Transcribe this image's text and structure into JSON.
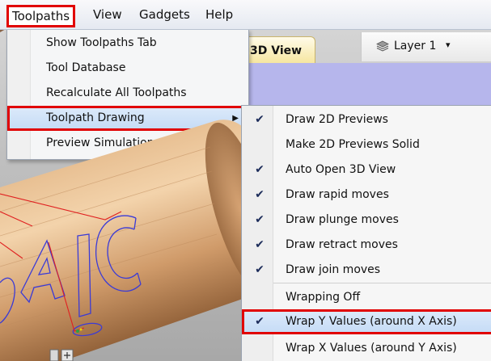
{
  "menubar": {
    "items": [
      {
        "label": "Toolpaths",
        "active": true
      },
      {
        "label": "View"
      },
      {
        "label": "Gadgets"
      },
      {
        "label": "Help"
      }
    ]
  },
  "view_tab": {
    "label": "3D View"
  },
  "layer": {
    "label": "Layer 1",
    "caret": "▾"
  },
  "toolpaths_menu": {
    "items": [
      {
        "label": "Show Toolpaths Tab"
      },
      {
        "label": "Tool Database"
      },
      {
        "label": "Recalculate All Toolpaths"
      },
      {
        "label": "Toolpath Drawing",
        "arrow": "▶",
        "highlighted": true
      },
      {
        "label": "Preview Simulation Op",
        "arrow": "▶"
      }
    ]
  },
  "toolpath_drawing_submenu": {
    "items": [
      {
        "label": "Draw 2D Previews",
        "checked": true,
        "check": "✔"
      },
      {
        "label": "Make 2D Previews Solid",
        "checked": false,
        "check": ""
      },
      {
        "label": "Auto Open 3D View",
        "checked": true,
        "check": "✔"
      },
      {
        "label": "Draw rapid moves",
        "checked": true,
        "check": "✔"
      },
      {
        "label": "Draw plunge moves",
        "checked": true,
        "check": "✔"
      },
      {
        "label": "Draw retract moves",
        "checked": true,
        "check": "✔"
      },
      {
        "label": "Draw join moves",
        "checked": true,
        "check": "✔"
      },
      {
        "label": "Wrapping Off",
        "checked": false,
        "check": ""
      },
      {
        "label": "Wrap Y Values (around X Axis)",
        "checked": true,
        "check": "✔",
        "highlighted": true
      },
      {
        "label": "Wrap X Values (around Y Axis)",
        "checked": false,
        "check": ""
      }
    ]
  },
  "colors": {
    "highlight_border": "#e10000",
    "menu_highlight": "#c6dcf6",
    "view_band": "#b6b6ec",
    "toolpath_text": "#3b3bd6",
    "rapid_move": "#e02020",
    "wood": "#d6a577"
  }
}
